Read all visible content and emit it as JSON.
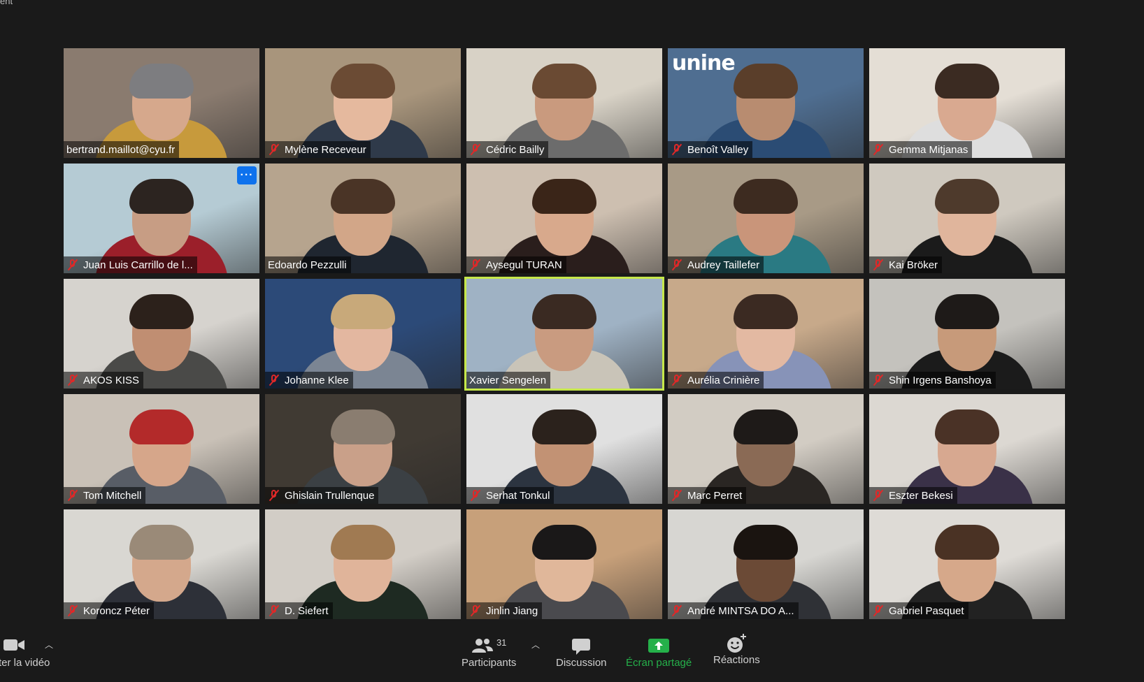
{
  "corner_text": "ent",
  "participants": [
    {
      "name": "bertrand.maillot@cyu.fr",
      "muted": false,
      "bg": "#8a7b6f",
      "skin": "#d6a88c",
      "hair": "#7d7d80",
      "shirt": "#c79a3c"
    },
    {
      "name": "Mylène Receveur",
      "muted": true,
      "bg": "#a8957c",
      "skin": "#e5b99e",
      "hair": "#6b4b34",
      "shirt": "#2f3a4a"
    },
    {
      "name": "Cédric Bailly",
      "muted": true,
      "bg": "#d8d2c6",
      "skin": "#c99a7e",
      "hair": "#6a4a33",
      "shirt": "#6c6c6c"
    },
    {
      "name": "Benoît Valley",
      "muted": true,
      "bg": "#4f6e91",
      "skin": "#b88c70",
      "hair": "#5a3e2a",
      "shirt": "#2b4c74",
      "logo": "unine"
    },
    {
      "name": "Gemma Mitjanas",
      "muted": true,
      "bg": "#e4ded5",
      "skin": "#d9a990",
      "hair": "#3b2b22",
      "shirt": "#dedede"
    },
    {
      "name": "Juan Luis Carrillo de l...",
      "muted": true,
      "bg": "#b5cbd4",
      "skin": "#c79d84",
      "hair": "#2c2420",
      "shirt": "#9b1f2a",
      "more": true
    },
    {
      "name": "Edoardo Pezzulli",
      "muted": false,
      "bg": "#b6a48e",
      "skin": "#d2a688",
      "hair": "#4a3426",
      "shirt": "#1f2630"
    },
    {
      "name": "Aysegul TURAN",
      "muted": true,
      "bg": "#cdbfb0",
      "skin": "#d8a98c",
      "hair": "#3a2518",
      "shirt": "#2a1e1c"
    },
    {
      "name": "Audrey Taillefer",
      "muted": true,
      "bg": "#a89a86",
      "skin": "#c9957a",
      "hair": "#3d2b20",
      "shirt": "#2a7a83"
    },
    {
      "name": "Kai Bröker",
      "muted": true,
      "bg": "#cfc9bf",
      "skin": "#e0b59c",
      "hair": "#4e3a2c",
      "shirt": "#1b1b1b"
    },
    {
      "name": "AKOS KISS",
      "muted": true,
      "bg": "#d6d3ce",
      "skin": "#c08e72",
      "hair": "#2c211b",
      "shirt": "#4a4a48"
    },
    {
      "name": "Johanne Klee",
      "muted": true,
      "bg": "#2c4a78",
      "skin": "#e3b7a0",
      "hair": "#c8a97a",
      "shirt": "#7b8593"
    },
    {
      "name": "Xavier Sengelen",
      "muted": false,
      "active": true,
      "bg": "#9fb2c4",
      "skin": "#c99b80",
      "hair": "#3a2a22",
      "shirt": "#c9c4b8"
    },
    {
      "name": "Aurélia Crinière",
      "muted": true,
      "bg": "#c7a98a",
      "skin": "#e3b9a2",
      "hair": "#3b2a22",
      "shirt": "#8793b8"
    },
    {
      "name": "Shin Irgens Banshoya",
      "muted": true,
      "bg": "#c4c2bd",
      "skin": "#c79a7a",
      "hair": "#1e1a18",
      "shirt": "#1b1b1b"
    },
    {
      "name": "Tom Mitchell",
      "muted": true,
      "bg": "#c9c1b7",
      "skin": "#d6a68a",
      "hair": "#b32a2a",
      "shirt": "#585d66"
    },
    {
      "name": "Ghislain Trullenque",
      "muted": true,
      "bg": "#403a33",
      "skin": "#c9a089",
      "hair": "#8a7d70",
      "shirt": "#3b4044"
    },
    {
      "name": "Serhat Tonkul",
      "muted": true,
      "bg": "#e0e0e0",
      "skin": "#c29274",
      "hair": "#2b221c",
      "shirt": "#2c3440"
    },
    {
      "name": "Marc Perret",
      "muted": true,
      "bg": "#d2ccc3",
      "skin": "#8a6a55",
      "hair": "#1e1a18",
      "shirt": "#2a2623"
    },
    {
      "name": "Eszter Bekesi",
      "muted": true,
      "bg": "#dcd8d2",
      "skin": "#d7a890",
      "hair": "#4a3226",
      "shirt": "#3a3148"
    },
    {
      "name": "Koroncz Péter",
      "muted": true,
      "bg": "#d9d7d2",
      "skin": "#d4a88c",
      "hair": "#9a8a78",
      "shirt": "#2d3038"
    },
    {
      "name": "D. Siefert",
      "muted": true,
      "bg": "#d2cdc6",
      "skin": "#e0b49a",
      "hair": "#a07a52",
      "shirt": "#1e2a22"
    },
    {
      "name": "Jinlin Jiang",
      "muted": true,
      "bg": "#c7a07a",
      "skin": "#e0b79a",
      "hair": "#1a1818",
      "shirt": "#4a4a4e"
    },
    {
      "name": "André MINTSA DO A...",
      "muted": true,
      "bg": "#d7d6d2",
      "skin": "#6b4a36",
      "hair": "#1a1410",
      "shirt": "#2f3136"
    },
    {
      "name": "Gabriel Pasquet",
      "muted": true,
      "bg": "#dedbd6",
      "skin": "#d6a88a",
      "hair": "#4a3224",
      "shirt": "#222"
    }
  ],
  "toolbar": {
    "video_label": "ter la vidéo",
    "participants_label": "Participants",
    "participants_count": "31",
    "chat_label": "Discussion",
    "share_label": "Écran partagé",
    "reactions_label": "Réactions",
    "share_color": "#25b04a"
  }
}
